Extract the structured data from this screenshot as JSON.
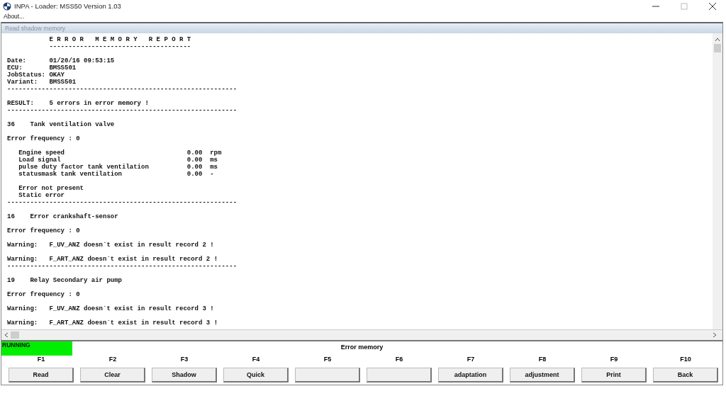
{
  "window": {
    "title": "INPA - Loader:  MSS50 Version 1.03"
  },
  "menu": [
    {
      "label": "About..."
    }
  ],
  "panel": {
    "caption": "Read shadow memory"
  },
  "report": {
    "blocks": [
      [
        {
          "kind": "title",
          "text": "E R R O R   M E M O R Y   R E P O R T"
        },
        {
          "kind": "title",
          "text": "-------------------------------------"
        }
      ],
      [
        {
          "kind": "field",
          "label": "Date:",
          "value": "01/20/16 09:53:15"
        },
        {
          "kind": "field",
          "label": "ECU:",
          "value": "BMSS501"
        },
        {
          "kind": "field",
          "label": "JobStatus:",
          "value": "OKAY"
        },
        {
          "kind": "field",
          "label": "Variant:",
          "value": "BMSS501"
        },
        {
          "kind": "rule",
          "text": "------------------------------------------------------------"
        }
      ],
      [
        {
          "kind": "field",
          "label": "RESULT:",
          "value": "5 errors in error memory !"
        },
        {
          "kind": "rule",
          "text": "------------------------------------------------------------"
        }
      ],
      [
        {
          "kind": "heading",
          "code": "36",
          "title": "Tank ventilation valve"
        }
      ],
      [
        {
          "kind": "text",
          "text": "Error frequency : 0"
        }
      ],
      [
        {
          "kind": "measure",
          "name": "Engine speed",
          "value": "0.00",
          "unit": "rpm"
        },
        {
          "kind": "measure",
          "name": "Load signal",
          "value": "0.00",
          "unit": "ms"
        },
        {
          "kind": "measure",
          "name": "pulse duty factor tank ventilation",
          "value": "0.00",
          "unit": "ms"
        },
        {
          "kind": "measure",
          "name": "statusmask tank ventilation",
          "value": "0.00",
          "unit": "-"
        }
      ],
      [
        {
          "kind": "note",
          "text": "Error not present"
        },
        {
          "kind": "note",
          "text": "Static error"
        },
        {
          "kind": "rule",
          "text": "------------------------------------------------------------"
        }
      ],
      [
        {
          "kind": "heading",
          "code": "16",
          "title": "Error crankshaft-sensor"
        }
      ],
      [
        {
          "kind": "text",
          "text": "Error frequency : 0"
        }
      ],
      [
        {
          "kind": "field",
          "label": "Warning:",
          "value": "F_UV_ANZ doesn´t exist in result record 2 !"
        }
      ],
      [
        {
          "kind": "field",
          "label": "Warning:",
          "value": "F_ART_ANZ doesn´t exist in result record 2 !"
        },
        {
          "kind": "rule",
          "text": "------------------------------------------------------------"
        }
      ],
      [
        {
          "kind": "heading",
          "code": "19",
          "title": "Relay Secondary air pump"
        }
      ],
      [
        {
          "kind": "text",
          "text": "Error frequency : 0"
        }
      ],
      [
        {
          "kind": "field",
          "label": "Warning:",
          "value": "F_UV_ANZ doesn´t exist in result record 3 !"
        }
      ],
      [
        {
          "kind": "field",
          "label": "Warning:",
          "value": "F_ART_ANZ doesn´t exist in result record 3 !"
        }
      ]
    ]
  },
  "status": {
    "text": "RUNNING",
    "color": "#00ee00",
    "title": "Error memory"
  },
  "function_keys": [
    {
      "key": "F1",
      "label": "Read"
    },
    {
      "key": "F2",
      "label": "Clear"
    },
    {
      "key": "F3",
      "label": "Shadow"
    },
    {
      "key": "F4",
      "label": "Quick"
    },
    {
      "key": "F5"
    },
    {
      "key": "F6"
    },
    {
      "key": "F7",
      "label": "adaptation"
    },
    {
      "key": "F8",
      "label": "adjustment"
    },
    {
      "key": "F9",
      "label": "Print"
    },
    {
      "key": "F10",
      "label": "Back"
    }
  ]
}
